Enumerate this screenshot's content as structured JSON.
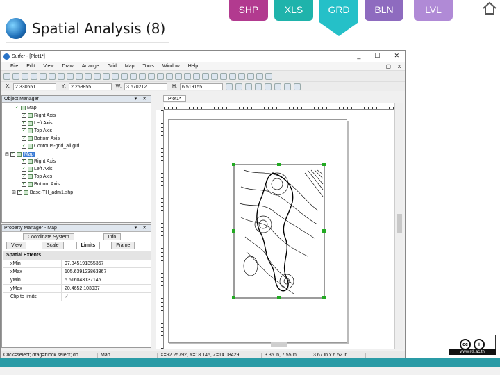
{
  "slide": {
    "title": "Spatial Analysis (8)",
    "tabs": [
      "SHP",
      "XLS",
      "GRD",
      "BLN",
      "LVL"
    ],
    "license_url": "www.rdi.ac.th"
  },
  "app": {
    "window_title": "Surfer - [Plot1*]",
    "win_controls": [
      "_",
      "☐",
      "✕"
    ],
    "mdi_controls": [
      "_",
      "▢",
      "x"
    ],
    "menu": [
      "File",
      "Edit",
      "View",
      "Draw",
      "Arrange",
      "Grid",
      "Map",
      "Tools",
      "Window",
      "Help"
    ],
    "coords": {
      "x_label": "X:",
      "x_value": "2.330651",
      "y_label": "Y:",
      "y_value": "2.258855",
      "w_label": "W:",
      "w_value": "3.670212",
      "h_label": "H:",
      "h_value": "6.519155"
    },
    "object_manager": {
      "title": "Object Manager",
      "items": [
        "Map",
        "Right Axis",
        "Left Axis",
        "Top Axis",
        "Bottom Axis",
        "Contours-grid_all.grd",
        "Map",
        "Right Axis",
        "Left Axis",
        "Top Axis",
        "Bottom Axis",
        "Base-TH_adm1.shp"
      ]
    },
    "property_manager": {
      "title": "Property Manager - Map",
      "tabs_row1": [
        "Coordinate System",
        "Info"
      ],
      "tabs_row2": [
        "View",
        "Scale",
        "Limits",
        "Frame"
      ],
      "group": "Spatial Extents",
      "rows": [
        {
          "key": "xMin",
          "value": "97.345191355367"
        },
        {
          "key": "xMax",
          "value": "105.639123863367"
        },
        {
          "key": "yMin",
          "value": "5.616043137146"
        },
        {
          "key": "yMax",
          "value": "20.4652 103937"
        },
        {
          "key": "Clip to limits",
          "value": "✓"
        }
      ]
    },
    "doc_tab": "Plot1*",
    "status": {
      "hint": "Click=select; drag=block select; do...",
      "object": "Map",
      "position": "X=92.25792, Y=18.145, Z=14.08429",
      "page_pos": "3.35 in, 7.55 in",
      "size": "3.67 in x 6.52 in"
    }
  },
  "colors": {
    "shp": "#b23a8f",
    "xls": "#1fb3ab",
    "grd": "#25c0c8",
    "bln": "#8e6bbf",
    "lvl": "#b08ad6",
    "accent_bar": "#2a9ba6",
    "selection": "#3a7bd5",
    "handles": "#22aa22"
  },
  "icons": [
    "home-icon",
    "globe-icon",
    "cc-icon",
    "by-icon",
    "collapse-icon",
    "checkbox-icon"
  ]
}
